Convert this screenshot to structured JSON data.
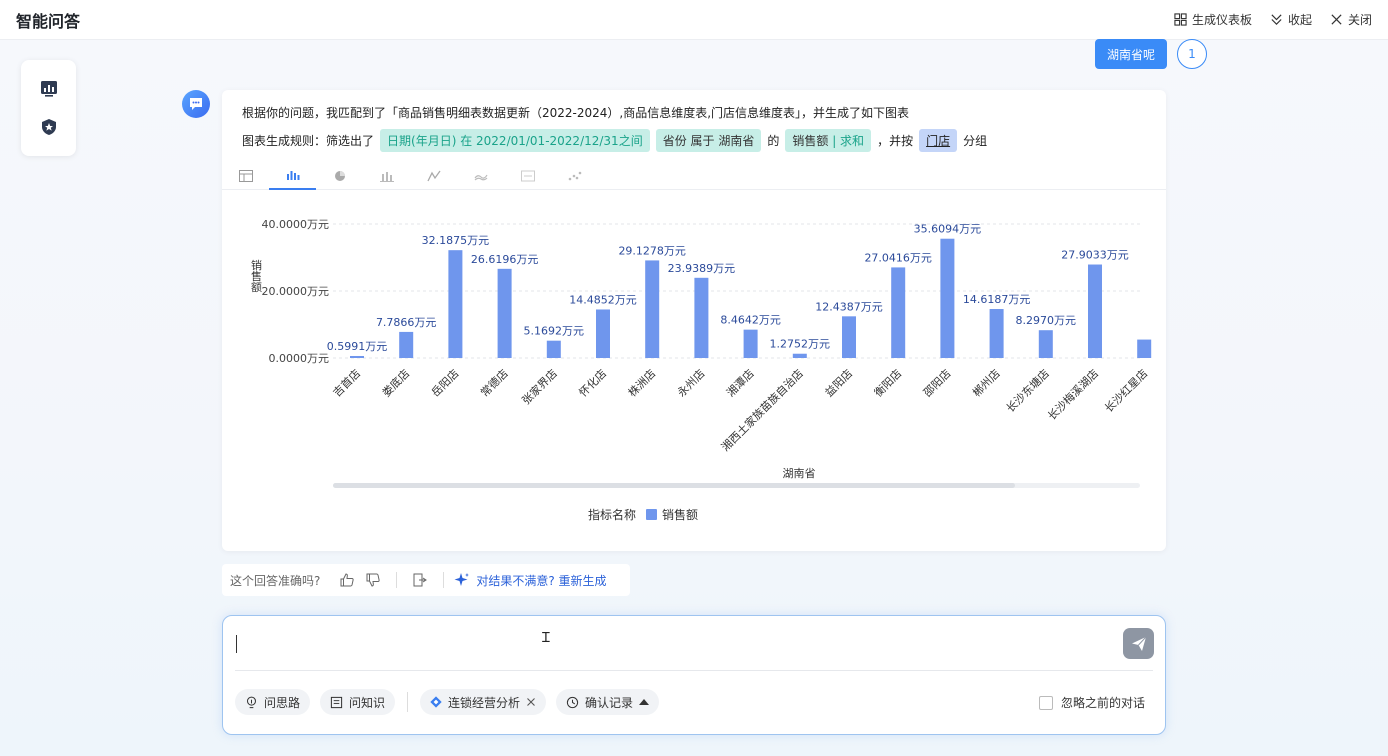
{
  "header": {
    "title": "智能问答",
    "generate_dashboard": "生成仪表板",
    "collapse": "收起",
    "close": "关闭"
  },
  "user_message": {
    "text": "湖南省呢",
    "avatar_label": "1"
  },
  "answer": {
    "line1": "根据你的问题，我匹配到了「商品销售明细表数据更新（2022-2024）,商品信息维度表,门店信息维度表」，并生成了如下图表",
    "rule_prefix": "图表生成规则：筛选出了",
    "date_chip_prefix": "日期(年月日) 在",
    "date_chip_value": "2022/01/01-2022/12/31之间",
    "province_chip": "省份 属于 湖南省",
    "of_text": "的",
    "measure_chip_name": "销售额",
    "measure_chip_agg": "| 求和",
    "group_prefix": "，并按",
    "group_chip": "门店",
    "group_suffix": "分组"
  },
  "chart_tabs": [
    {
      "icon": "table-icon",
      "active": false
    },
    {
      "icon": "bar-chart-icon",
      "active": true
    },
    {
      "icon": "pie-chart-icon",
      "active": false
    },
    {
      "icon": "stacked-bar-icon",
      "active": false
    },
    {
      "icon": "line-chart-icon",
      "active": false
    },
    {
      "icon": "area-chart-icon",
      "active": false
    },
    {
      "icon": "number-card-icon",
      "active": false
    },
    {
      "icon": "scatter-chart-icon",
      "active": false
    }
  ],
  "chart_data": {
    "type": "bar",
    "title": "",
    "xlabel": "湖南省",
    "ylabel": "销售额",
    "ylim": [
      0,
      40
    ],
    "yticks": [
      "0.0000万元",
      "20.0000万元",
      "40.0000万元"
    ],
    "ytick_values": [
      0,
      20,
      40
    ],
    "categories": [
      "吉首店",
      "娄底店",
      "岳阳店",
      "常德店",
      "张家界店",
      "怀化店",
      "株洲店",
      "永州店",
      "湘潭店",
      "湘西土家族苗族自治店",
      "益阳店",
      "衡阳店",
      "邵阳店",
      "郴州店",
      "长沙东塘店",
      "长沙梅溪湖店",
      "长沙红星店"
    ],
    "series": [
      {
        "name": "销售额",
        "values": [
          0.5991,
          7.7866,
          32.1875,
          26.6196,
          5.1692,
          14.4852,
          29.1278,
          23.9389,
          8.4642,
          1.2752,
          12.4387,
          27.0416,
          35.6094,
          14.6187,
          8.297,
          27.9033,
          5.5
        ],
        "labels": [
          "0.5991万元",
          "7.7866万元",
          "32.1875万元",
          "26.6196万元",
          "5.1692万元",
          "14.4852万元",
          "29.1278万元",
          "23.9389万元",
          "8.4642万元",
          "1.2752万元",
          "12.4387万元",
          "27.0416万元",
          "35.6094万元",
          "14.6187万元",
          "8.2970万元",
          "27.9033万元",
          ""
        ]
      }
    ],
    "grid": true,
    "legend_title": "指标名称",
    "legend": [
      "销售额"
    ],
    "legend_position": "bottom",
    "color": "#6f96ed"
  },
  "feedback": {
    "question": "这个回答准确吗?",
    "regenerate": "对结果不满意? 重新生成"
  },
  "input": {
    "value": "",
    "placeholder": ""
  },
  "tools": {
    "ask_thought": "问思路",
    "ask_knowledge": "问知识",
    "chain_analysis": "连锁经营分析",
    "confirm_records": "确认记录",
    "ignore_history": "忽略之前的对话"
  },
  "colors": {
    "accent": "#3a8bf7",
    "bar": "#6f96ed",
    "chip_green": "#c7eee7",
    "chip_blue": "#c4d5f8"
  }
}
